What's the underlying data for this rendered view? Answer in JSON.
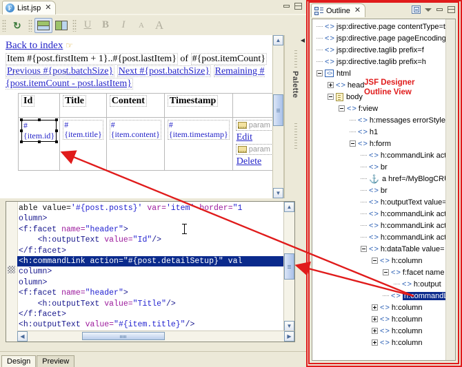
{
  "editor": {
    "tab": {
      "label": "List.jsp",
      "icon": "file-icon",
      "close": "✕"
    },
    "window_buttons": {
      "minimize": "minimize",
      "maximize": "maximize"
    },
    "toolbar": {
      "refresh": "↻",
      "layout_horizontal": "layout-horizontal",
      "layout_vertical": "layout-vertical",
      "underline": "U",
      "bold": "B",
      "italic": "I",
      "font_smaller": "A",
      "font_larger": "A"
    },
    "canvas": {
      "back_link": "Back to index",
      "paragraph": [
        "Item #{post.firstItem + 1}..#{post.lastItem}",
        " of ",
        "#{post.itemCount}",
        "Previous #{post.batchSize}",
        "Next #{post.batchSize}",
        "Remaining #{post.itemCount - post.lastItem}"
      ],
      "table": {
        "headers": [
          "Id",
          "Title",
          "Content",
          "Timestamp",
          ""
        ],
        "row": {
          "id": "#{item.id}",
          "title": "#{item.title}",
          "content": "#{item.content}",
          "timestamp": "#{item.timestamp}",
          "actions": {
            "param1": "param",
            "edit": "Edit",
            "param2": "param",
            "delete": "Delete"
          }
        }
      }
    },
    "palette": {
      "label": "Palette"
    },
    "source": {
      "lines": [
        [
          {
            "t": "able value=",
            "c": "txt"
          },
          {
            "t": "'#{post.posts}'",
            "c": "val"
          },
          {
            "t": " ",
            "c": "txt"
          },
          {
            "t": "var=",
            "c": "attr"
          },
          {
            "t": "'item'",
            "c": "val"
          },
          {
            "t": " ",
            "c": "txt"
          },
          {
            "t": "border=",
            "c": "attr"
          },
          {
            "t": "\"1",
            "c": "val"
          }
        ],
        [
          {
            "t": "olumn>",
            "c": "tag"
          }
        ],
        [
          {
            "t": "<f:facet ",
            "c": "tag"
          },
          {
            "t": "name=",
            "c": "attr"
          },
          {
            "t": "\"header\"",
            "c": "val"
          },
          {
            "t": ">",
            "c": "tag"
          }
        ],
        [
          {
            "t": "    <h:outputText ",
            "c": "tag"
          },
          {
            "t": "value=",
            "c": "attr"
          },
          {
            "t": "\"Id\"",
            "c": "val"
          },
          {
            "t": "/>",
            "c": "tag"
          }
        ],
        [
          {
            "t": "</f:facet>",
            "c": "tag"
          }
        ],
        [
          {
            "t": "<h:commandLink ",
            "c": "tag"
          },
          {
            "t": "action=",
            "c": "attr"
          },
          {
            "t": "\"#{post.detailSetup}\"",
            "c": "val"
          },
          {
            "t": " val",
            "c": "attr"
          }
        ],
        [
          {
            "t": "column>",
            "c": "tag"
          }
        ],
        [
          {
            "t": "olumn>",
            "c": "tag"
          }
        ],
        [
          {
            "t": "<f:facet ",
            "c": "tag"
          },
          {
            "t": "name=",
            "c": "attr"
          },
          {
            "t": "\"header\"",
            "c": "val"
          },
          {
            "t": ">",
            "c": "tag"
          }
        ],
        [
          {
            "t": "    <h:outputText ",
            "c": "tag"
          },
          {
            "t": "value=",
            "c": "attr"
          },
          {
            "t": "\"Title\"",
            "c": "val"
          },
          {
            "t": "/>",
            "c": "tag"
          }
        ],
        [
          {
            "t": "</f:facet>",
            "c": "tag"
          }
        ],
        [
          {
            "t": "<h:outputText ",
            "c": "tag"
          },
          {
            "t": "value=",
            "c": "attr"
          },
          {
            "t": "\"#{item.title}\"",
            "c": "val"
          },
          {
            "t": "/>",
            "c": "tag"
          }
        ]
      ],
      "highlighted_line_index": 5
    },
    "bottom_tabs": [
      {
        "label": "Design",
        "active": true
      },
      {
        "label": "Preview",
        "active": false
      }
    ]
  },
  "outline": {
    "tab": {
      "label": "Outline",
      "close": "✕"
    },
    "buttons": {
      "collapse_all": "collapse-all",
      "view_menu": "view-menu",
      "minimize": "minimize",
      "maximize": "maximize"
    },
    "annotation": {
      "line1": "JSF Designer",
      "line2": "Outline View"
    },
    "tree": [
      {
        "label": "jsp:directive.page contentType=tex",
        "indent": 0,
        "icon": "tag",
        "expander": "none"
      },
      {
        "label": "jsp:directive.page pageEncoding=UT",
        "indent": 0,
        "icon": "tag",
        "expander": "none"
      },
      {
        "label": "jsp:directive.taglib prefix=f",
        "indent": 0,
        "icon": "tag",
        "expander": "none"
      },
      {
        "label": "jsp:directive.taglib prefix=h",
        "indent": 0,
        "icon": "tag",
        "expander": "none"
      },
      {
        "label": "html",
        "indent": 0,
        "icon": "html",
        "expander": "minus"
      },
      {
        "label": "head",
        "indent": 1,
        "icon": "tag",
        "expander": "plus"
      },
      {
        "label": "body",
        "indent": 1,
        "icon": "body",
        "expander": "minus"
      },
      {
        "label": "f:view",
        "indent": 2,
        "icon": "tag",
        "expander": "minus"
      },
      {
        "label": "h:messages errorStyle=",
        "indent": 3,
        "icon": "tag",
        "expander": "none"
      },
      {
        "label": "h1",
        "indent": 3,
        "icon": "tag",
        "expander": "none"
      },
      {
        "label": "h:form",
        "indent": 3,
        "icon": "tag",
        "expander": "minus"
      },
      {
        "label": "h:commandLink actio",
        "indent": 4,
        "icon": "tag",
        "expander": "none"
      },
      {
        "label": "br",
        "indent": 4,
        "icon": "tag",
        "expander": "none"
      },
      {
        "label": "a href=/MyBlogCRUD",
        "indent": 4,
        "icon": "anchor",
        "expander": "none"
      },
      {
        "label": "br",
        "indent": 4,
        "icon": "tag",
        "expander": "none"
      },
      {
        "label": "h:outputText value=",
        "indent": 4,
        "icon": "tag",
        "expander": "none"
      },
      {
        "label": "h:commandLink actio",
        "indent": 4,
        "icon": "tag",
        "expander": "none"
      },
      {
        "label": "h:commandLink actio",
        "indent": 4,
        "icon": "tag",
        "expander": "none"
      },
      {
        "label": "h:commandLink actio",
        "indent": 4,
        "icon": "tag",
        "expander": "none"
      },
      {
        "label": "h:dataTable value=",
        "indent": 4,
        "icon": "tag",
        "expander": "minus"
      },
      {
        "label": "h:column",
        "indent": 5,
        "icon": "tag",
        "expander": "minus"
      },
      {
        "label": "f:facet name",
        "indent": 6,
        "icon": "tag",
        "expander": "minus"
      },
      {
        "label": "h:output",
        "indent": 7,
        "icon": "tag",
        "expander": "none"
      },
      {
        "label": "h:commandLi",
        "indent": 6,
        "icon": "tag",
        "expander": "none",
        "selected": true
      },
      {
        "label": "h:column",
        "indent": 5,
        "icon": "tag",
        "expander": "plus"
      },
      {
        "label": "h:column",
        "indent": 5,
        "icon": "tag",
        "expander": "plus"
      },
      {
        "label": "h:column",
        "indent": 5,
        "icon": "tag",
        "expander": "plus"
      },
      {
        "label": "h:column",
        "indent": 5,
        "icon": "tag",
        "expander": "plus"
      }
    ]
  },
  "colors": {
    "annotation_red": "#e01b1b",
    "selection_blue": "#0a2a8c",
    "link_blue": "#2424c8",
    "tag_color": "#16168c",
    "attr_color": "#9c1a9c",
    "value_color": "#2222d0"
  }
}
